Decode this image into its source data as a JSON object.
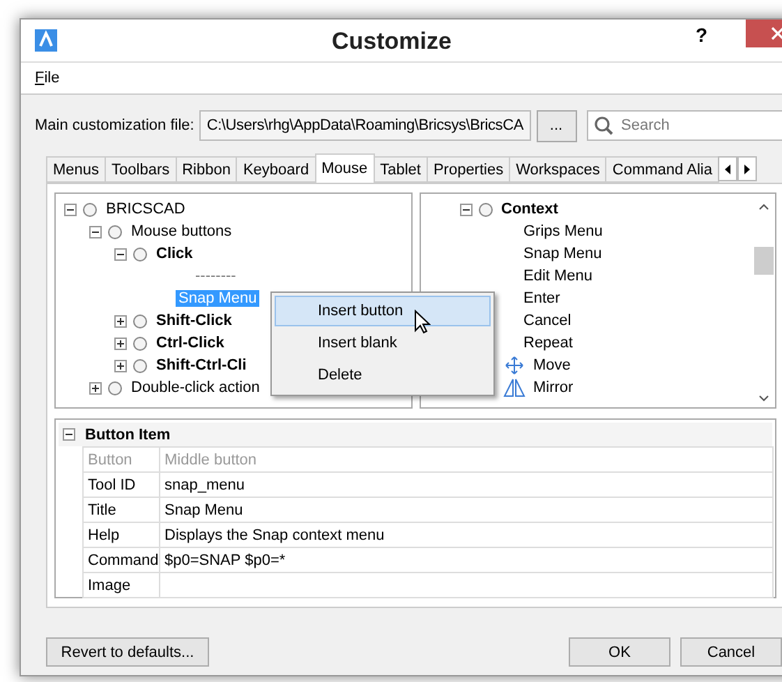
{
  "window": {
    "title": "Customize",
    "help": "?"
  },
  "menu": [
    "File"
  ],
  "file_row": {
    "label": "Main customization file:",
    "value": "C:\\Users\\rhg\\AppData\\Roaming\\Bricsys\\BricsCA",
    "browse": "...",
    "search": {
      "placeholder": "Search"
    }
  },
  "tabs": [
    {
      "label": "Menus",
      "selected": false
    },
    {
      "label": "Toolbars",
      "selected": false
    },
    {
      "label": "Ribbon",
      "selected": false
    },
    {
      "label": "Keyboard",
      "selected": false
    },
    {
      "label": "Mouse",
      "selected": true
    },
    {
      "label": "Tablet",
      "selected": false
    },
    {
      "label": "Properties",
      "selected": false
    },
    {
      "label": "Workspaces",
      "selected": false
    },
    {
      "label": "Command Alia",
      "selected": false
    }
  ],
  "left_tree": [
    {
      "label": "BRICSCAD",
      "kind": "folder",
      "expanded": true,
      "selected": false,
      "children": [
        {
          "label": "Mouse buttons",
          "kind": "folder",
          "expanded": true,
          "selected": false,
          "children": [
            {
              "label": "Click",
              "kind": "button",
              "expanded": true,
              "selected": false,
              "children": [
                {
                  "label": "--------",
                  "kind": "separator",
                  "selected": false
                },
                {
                  "label": "Snap Menu",
                  "kind": "item",
                  "selected": true
                }
              ]
            },
            {
              "label": "Shift-Click",
              "kind": "button",
              "expanded": false,
              "selected": false
            },
            {
              "label": "Ctrl-Click",
              "kind": "button",
              "expanded": false,
              "selected": false
            },
            {
              "label": "Shift-Ctrl-Cli",
              "kind": "button",
              "expanded": false,
              "selected": false
            }
          ]
        },
        {
          "label": "Double-click action",
          "kind": "folder",
          "expanded": false,
          "selected": false
        }
      ]
    }
  ],
  "right_tree": [
    {
      "label": "Context",
      "kind": "button",
      "expanded": true,
      "selected": false,
      "children": [
        {
          "label": "Grips Menu",
          "kind": "item",
          "selected": false
        },
        {
          "label": "Snap Menu",
          "kind": "item",
          "selected": false
        },
        {
          "label": "Edit Menu",
          "kind": "item",
          "selected": false
        },
        {
          "label": "Enter",
          "kind": "item",
          "selected": false
        },
        {
          "label": "Cancel",
          "kind": "item",
          "selected": false
        },
        {
          "label": "Repeat",
          "kind": "item",
          "selected": false
        },
        {
          "label": "Move",
          "kind": "move",
          "selected": false
        },
        {
          "label": "Mirror",
          "kind": "mirror",
          "selected": false
        }
      ]
    }
  ],
  "context_menu": [
    {
      "label": "Insert button",
      "selected": true
    },
    {
      "label": "Insert blank",
      "selected": false
    },
    {
      "label": "Delete",
      "selected": false
    }
  ],
  "properties": {
    "title": "Button Item",
    "expanded": true,
    "rows": [
      {
        "name": "Button",
        "value": "Middle button",
        "disabled": true
      },
      {
        "name": "Tool ID",
        "value": "snap_menu",
        "disabled": false
      },
      {
        "name": "Title",
        "value": "Snap Menu",
        "disabled": false
      },
      {
        "name": "Help",
        "value": "Displays the Snap context menu",
        "disabled": false
      },
      {
        "name": "Command",
        "value": "$p0=SNAP $p0=*",
        "disabled": false
      },
      {
        "name": "Image",
        "value": "",
        "disabled": false
      }
    ]
  },
  "buttons": {
    "revert": "Revert to defaults...",
    "ok": "OK",
    "cancel": "Cancel"
  }
}
